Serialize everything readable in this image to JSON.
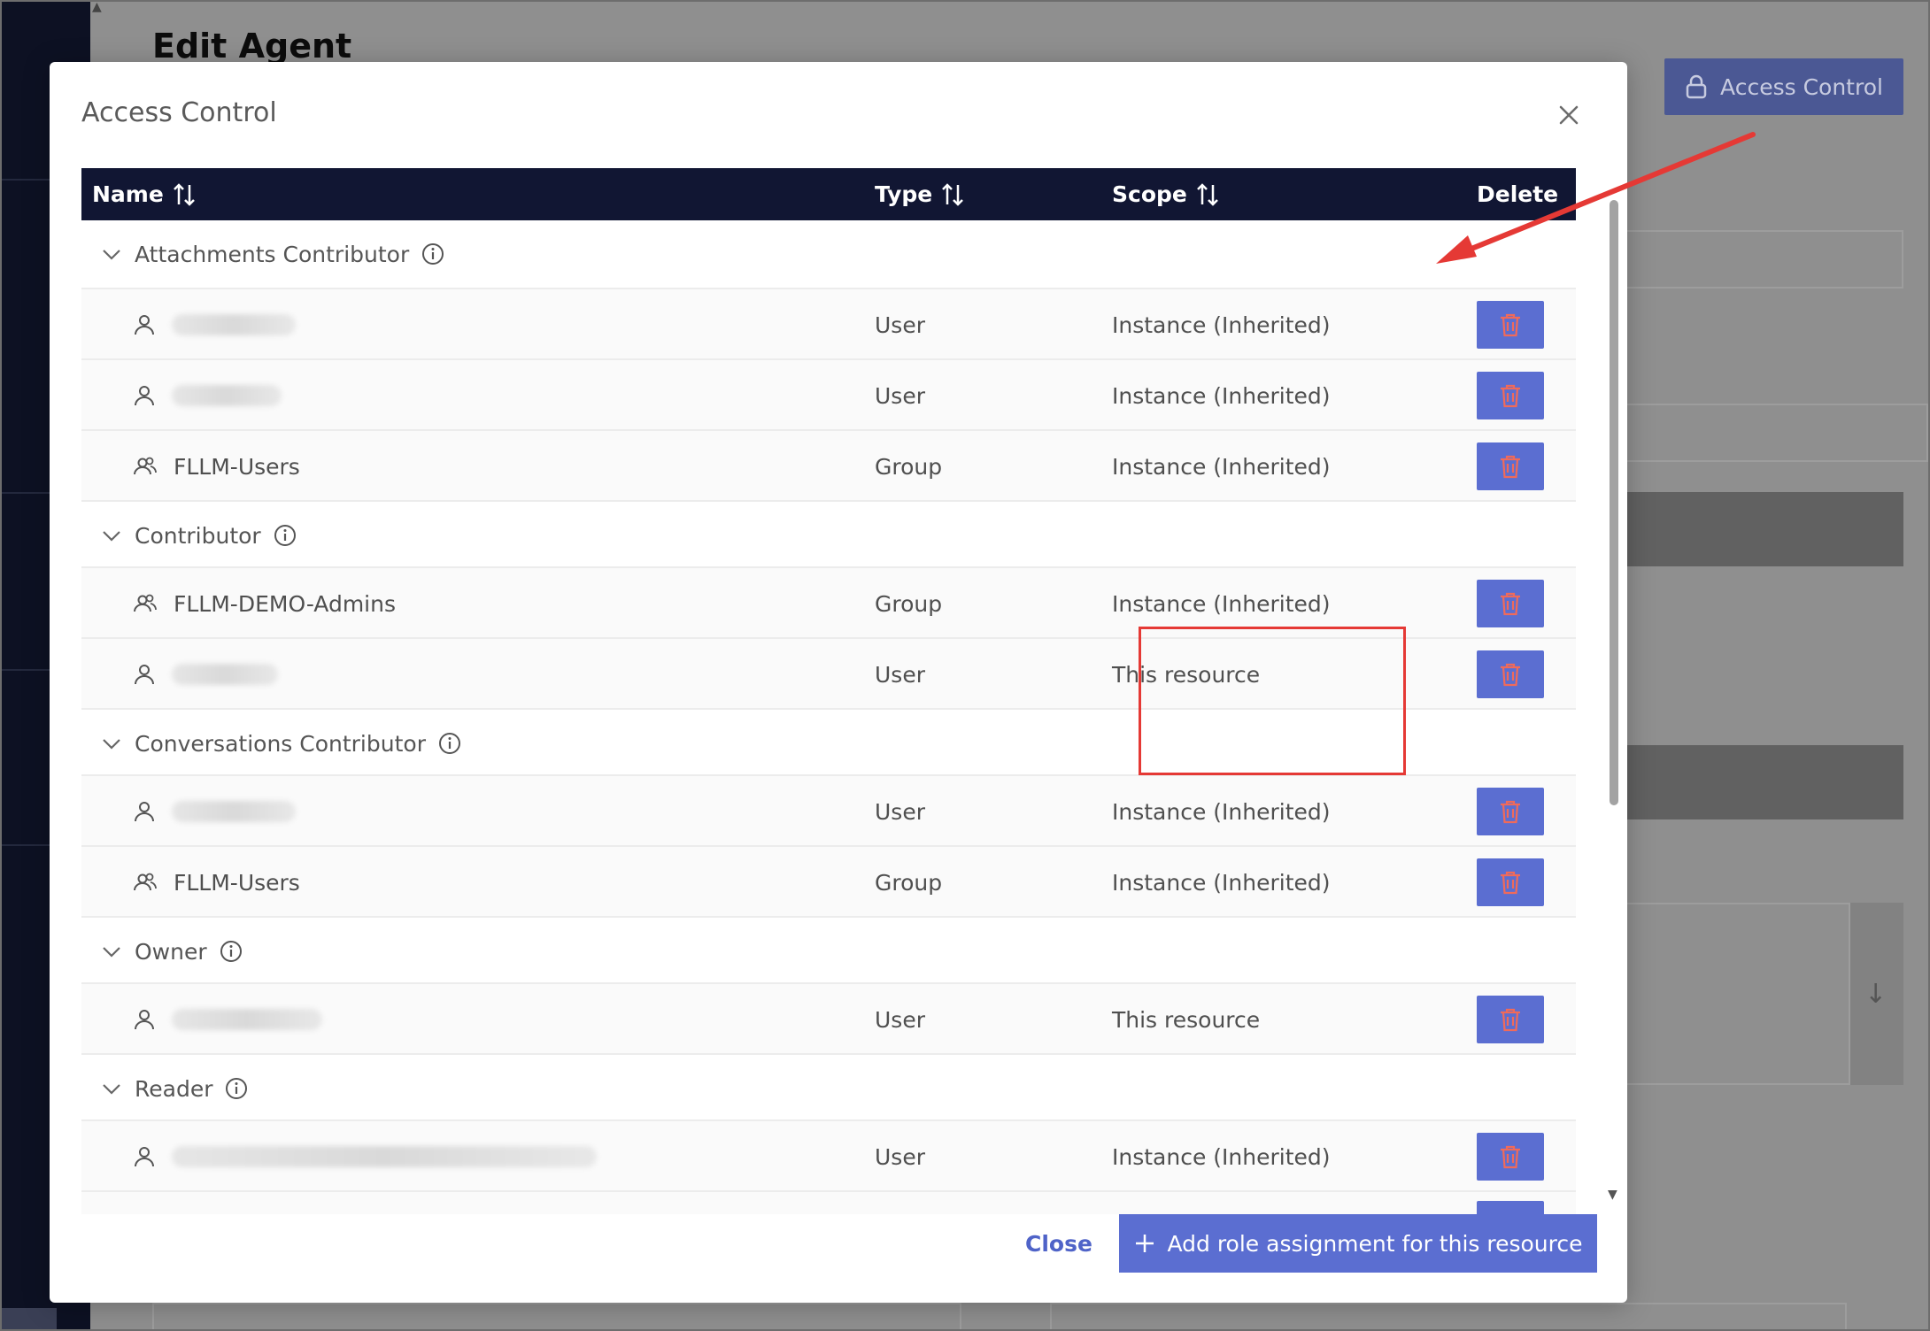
{
  "background": {
    "page_title": "Edit Agent",
    "access_control_button": "Access Control"
  },
  "modal": {
    "title": "Access Control",
    "columns": {
      "name": "Name",
      "type": "Type",
      "scope": "Scope",
      "delete": "Delete"
    },
    "groups": [
      {
        "role": "Attachments Contributor",
        "rows": [
          {
            "name": "",
            "type": "User",
            "scope": "Instance (Inherited)",
            "icon": "user-icon"
          },
          {
            "name": "",
            "type": "User",
            "scope": "Instance (Inherited)",
            "icon": "user-icon"
          },
          {
            "name": "FLLM-Users",
            "type": "Group",
            "scope": "Instance (Inherited)",
            "icon": "group-icon"
          }
        ]
      },
      {
        "role": "Contributor",
        "rows": [
          {
            "name": "FLLM-DEMO-Admins",
            "type": "Group",
            "scope": "Instance (Inherited)",
            "icon": "group-icon"
          },
          {
            "name": "",
            "type": "User",
            "scope": "This resource",
            "icon": "user-icon"
          }
        ]
      },
      {
        "role": "Conversations Contributor",
        "rows": [
          {
            "name": "",
            "type": "User",
            "scope": "Instance (Inherited)",
            "icon": "user-icon"
          },
          {
            "name": "FLLM-Users",
            "type": "Group",
            "scope": "Instance (Inherited)",
            "icon": "group-icon"
          }
        ]
      },
      {
        "role": "Owner",
        "rows": [
          {
            "name": "",
            "type": "User",
            "scope": "This resource",
            "icon": "user-icon"
          }
        ]
      },
      {
        "role": "Reader",
        "rows": [
          {
            "name": "",
            "type": "User",
            "scope": "Instance (Inherited)",
            "icon": "user-icon"
          }
        ]
      }
    ],
    "footer": {
      "close_label": "Close",
      "add_label": "Add role assignment for this resource"
    }
  },
  "colors": {
    "header_bg": "#111633",
    "accent": "#5b6ed1",
    "delete_icon": "#f06a5a",
    "annotation_red": "#e53935"
  }
}
